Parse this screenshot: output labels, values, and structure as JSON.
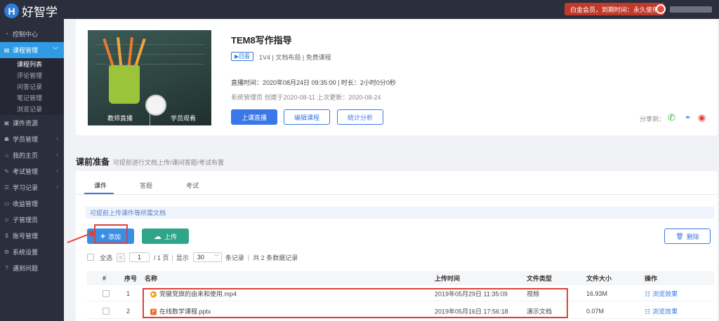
{
  "brand": {
    "logo_letter": "H",
    "name": "好智学"
  },
  "header": {
    "vip_status": "白金会员，到期时间：永久使用"
  },
  "sidebar": {
    "items": [
      {
        "label": "控制中心",
        "icon": "dashboard-icon"
      },
      {
        "label": "课程管理",
        "icon": "book-icon",
        "active": true
      },
      {
        "label": "课件资源",
        "icon": "folder-icon"
      },
      {
        "label": "学员管理",
        "icon": "users-icon"
      },
      {
        "label": "我的主页",
        "icon": "home-icon"
      },
      {
        "label": "考试管理",
        "icon": "exam-icon"
      },
      {
        "label": "学习记录",
        "icon": "record-icon"
      },
      {
        "label": "收益管理",
        "icon": "wallet-icon"
      },
      {
        "label": "子管理员",
        "icon": "admin-icon"
      },
      {
        "label": "账号管理",
        "icon": "dollar-icon"
      },
      {
        "label": "系统设置",
        "icon": "settings-icon"
      },
      {
        "label": "遇到问题",
        "icon": "help-icon"
      }
    ],
    "submenu": [
      "课程列表",
      "评论管理",
      "问答记录",
      "笔记管理",
      "浏览记录"
    ]
  },
  "course": {
    "title": "TEM8写作指导",
    "replay_tag": "▶回看",
    "meta": "1V4 | 文档布局 | 免费课程",
    "live_time": "直播时间：2020年08月24日 09:35:00 | 时长：2小时0分0秒",
    "creator_info": "系统管理员 创建于2020-08-11 上次更新：2020-08-24",
    "cover_label_left": "教师直播",
    "cover_label_right": "学员观看",
    "buttons": {
      "start": "上课直播",
      "edit": "编辑课程",
      "stats": "统计分析"
    },
    "share_label": "分享到："
  },
  "section": {
    "title": "课前准备",
    "desc": "可提前进行文档上传/课间答题/考试布置"
  },
  "tabs": [
    "课件",
    "答题",
    "考试"
  ],
  "notice": "可提前上传课件等所需文档",
  "actions": {
    "add": "添加",
    "upload": "上传",
    "delete": "删除"
  },
  "pager": {
    "select_all": "全选",
    "prev": "<",
    "page": "1",
    "total_pages": "/ 1 页",
    "show_label": "显示",
    "per_page": "30",
    "per_page_unit": "条记录",
    "summary": "共 2 条数据记录"
  },
  "table": {
    "headers": [
      "#",
      "序号",
      "名称",
      "上传时间",
      "文件类型",
      "文件大小",
      "操作"
    ],
    "rows": [
      {
        "index": "1",
        "name": "党徽党旗的由来和使用.mp4",
        "icon": "video-file-icon",
        "uploaded": "2019年05月29日 11:35:09",
        "type": "视频",
        "size": "16.93M",
        "op": "浏览效果"
      },
      {
        "index": "2",
        "name": "在线数学课程.pptx",
        "icon": "ppt-file-icon",
        "uploaded": "2019年05月16日 17:56:18",
        "type": "演示文档",
        "size": "0.07M",
        "op": "浏览效果"
      }
    ]
  }
}
